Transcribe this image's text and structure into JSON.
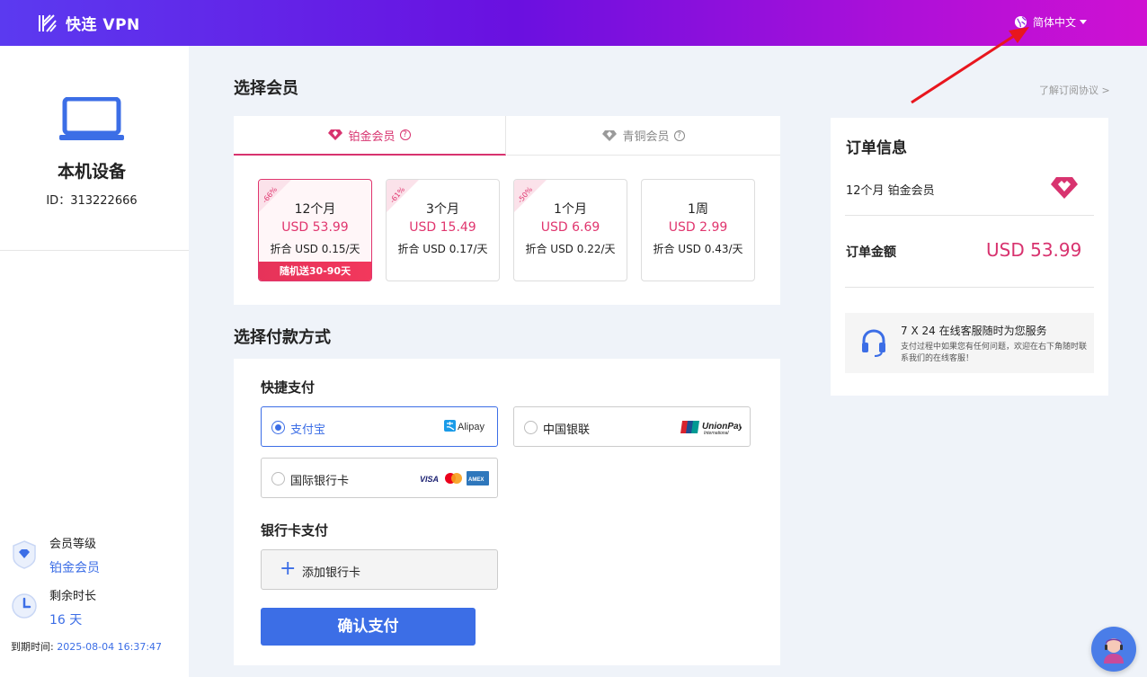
{
  "header": {
    "app_name": "快连 VPN",
    "language": "简体中文"
  },
  "sidebar": {
    "device_title": "本机设备",
    "device_id": "ID：313222666",
    "level_label": "会员等级",
    "level_value": "铂金会员",
    "remaining_label": "剩余时长",
    "remaining_value": "16 天",
    "expire_label": "到期时间:",
    "expire_value": "2025-08-04 16:37:47"
  },
  "main": {
    "select_member_title": "选择会员",
    "agreement_link": "了解订阅协议 >",
    "tabs": [
      {
        "label": "铂金会员",
        "active": true
      },
      {
        "label": "青铜会员",
        "active": false
      }
    ],
    "plans": [
      {
        "discount": "-66%",
        "name": "12个月",
        "price": "USD 53.99",
        "daily": "折合 USD 0.15/天",
        "bonus": "随机送30-90天",
        "selected": true
      },
      {
        "discount": "-61%",
        "name": "3个月",
        "price": "USD 15.49",
        "daily": "折合 USD 0.17/天",
        "selected": false
      },
      {
        "discount": "-50%",
        "name": "1个月",
        "price": "USD 6.69",
        "daily": "折合 USD 0.22/天",
        "selected": false
      },
      {
        "discount": "",
        "name": "1周",
        "price": "USD 2.99",
        "daily": "折合 USD 0.43/天",
        "selected": false
      }
    ],
    "payment_title": "选择付款方式",
    "quick_pay_title": "快捷支付",
    "payment_options": [
      {
        "label": "支付宝",
        "logo": "Alipay",
        "selected": true
      },
      {
        "label": "中国银联",
        "logo": "UnionPay",
        "selected": false
      },
      {
        "label": "国际银行卡",
        "logo": "VISA",
        "selected": false
      }
    ],
    "bank_pay_title": "银行卡支付",
    "add_card_label": "添加银行卡",
    "confirm_button": "确认支付"
  },
  "order": {
    "title": "订单信息",
    "item": "12个月 铂金会员",
    "amount_label": "订单金额",
    "amount_value": "USD 53.99",
    "service_title": "7 X 24 在线客服随时为您服务",
    "service_desc": "支付过程中如果您有任何问题，欢迎在右下角随时联系我们的在线客服！"
  },
  "colors": {
    "brand_blue": "#3c6ee6",
    "accent_pink": "#d8336f",
    "header_gradient_start": "#5b3af0",
    "header_gradient_end": "#cf11d2"
  }
}
